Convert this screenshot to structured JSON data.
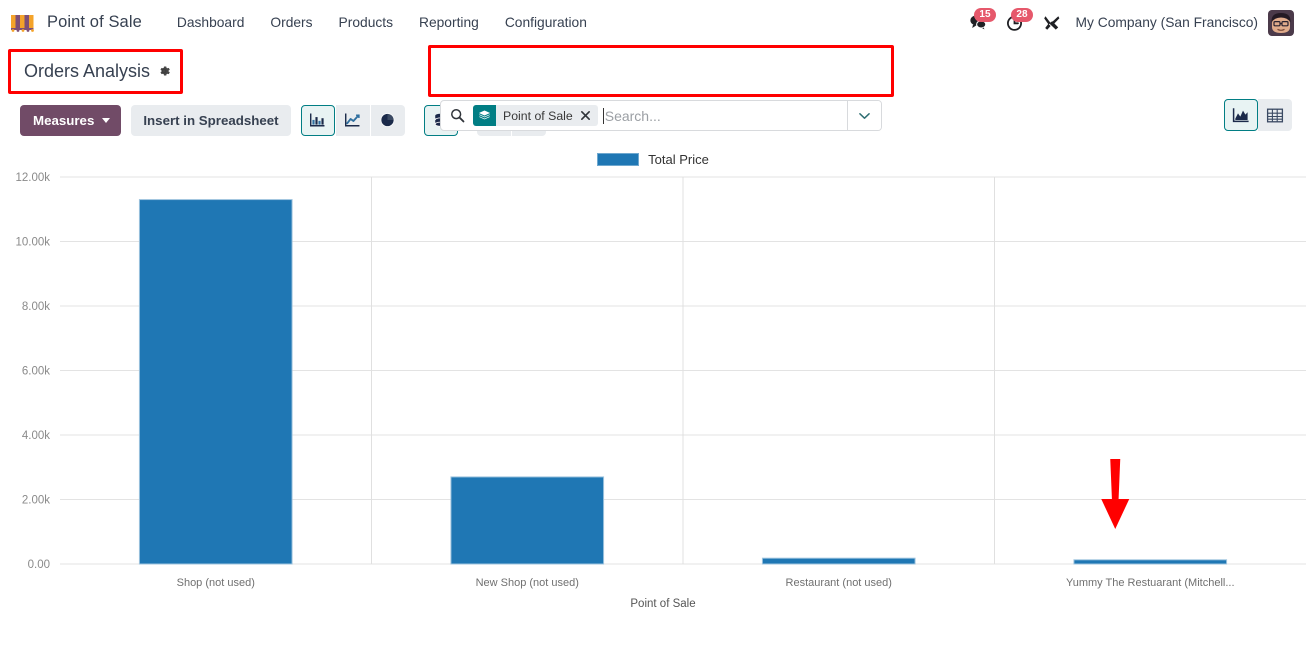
{
  "navbar": {
    "logo_icon": "pos-awning-icon",
    "brand": "Point of Sale",
    "menu": [
      {
        "label": "Dashboard",
        "name": "nav-dashboard"
      },
      {
        "label": "Orders",
        "name": "nav-orders"
      },
      {
        "label": "Products",
        "name": "nav-products"
      },
      {
        "label": "Reporting",
        "name": "nav-reporting"
      },
      {
        "label": "Configuration",
        "name": "nav-configuration"
      }
    ],
    "messages": {
      "icon": "messages-icon",
      "count": "15"
    },
    "activities": {
      "icon": "activities-clock-icon",
      "count": "28"
    },
    "apps_icon": "tools-wrench-icon",
    "company": "My Company (San Francisco)",
    "avatar_icon": "user-avatar"
  },
  "control_panel": {
    "breadcrumb_title": "Orders Analysis",
    "settings_icon": "gear-icon",
    "search": {
      "icon": "search-icon",
      "facet_icon": "layers-stack-icon",
      "facet_label": "Point of Sale",
      "facet_remove_icon": "close-x-icon",
      "placeholder": "Search...",
      "value": "",
      "dropdown_icon": "caret-down-icon"
    },
    "views": [
      {
        "name": "view-graph",
        "icon": "graph-chart-icon",
        "active": true
      },
      {
        "name": "view-pivot",
        "icon": "pivot-table-icon",
        "active": false
      }
    ]
  },
  "toolbar": {
    "measures_label": "Measures",
    "measures_caret_icon": "caret-down-icon",
    "spreadsheet_label": "Insert in Spreadsheet",
    "chart_buttons": [
      {
        "name": "chart-type-bar",
        "icon": "bar-chart-icon",
        "active": true
      },
      {
        "name": "chart-type-line",
        "icon": "line-chart-icon",
        "active": false
      },
      {
        "name": "chart-type-pie",
        "icon": "pie-chart-icon",
        "active": false
      }
    ],
    "stack_button": {
      "name": "toggle-stacked",
      "icon": "database-stack-icon",
      "active": true
    },
    "sort_buttons": [
      {
        "name": "sort-descending",
        "icon": "sort-amount-desc-icon",
        "active": false
      },
      {
        "name": "sort-ascending",
        "icon": "sort-amount-asc-icon",
        "active": false
      }
    ]
  },
  "annotations": {
    "box_breadcrumb_color": "#ff0000",
    "box_search_color": "#ff0000",
    "arrow_color": "#ff0000",
    "arrow_target": "Yummy The Restuarant (Mitchell..."
  },
  "chart_data": {
    "type": "bar",
    "title": "",
    "legend": [
      {
        "name": "Total Price",
        "color": "#1f77b4"
      }
    ],
    "legend_position": "top",
    "categories": [
      "Shop (not used)",
      "New Shop (not used)",
      "Restaurant (not used)",
      "Yummy The Restuarant (Mitchell..."
    ],
    "series": [
      {
        "name": "Total Price",
        "values": [
          11300,
          2700,
          180,
          130
        ]
      }
    ],
    "xlabel": "Point of Sale",
    "ylabel": "",
    "ylim": [
      0,
      12000
    ],
    "yticks": [
      0,
      2000,
      4000,
      6000,
      8000,
      10000,
      12000
    ],
    "ytick_labels": [
      "0.00",
      "2.00k",
      "4.00k",
      "6.00k",
      "8.00k",
      "10.00k",
      "12.00k"
    ],
    "grid": true,
    "bar_color": "#1f77b4"
  }
}
